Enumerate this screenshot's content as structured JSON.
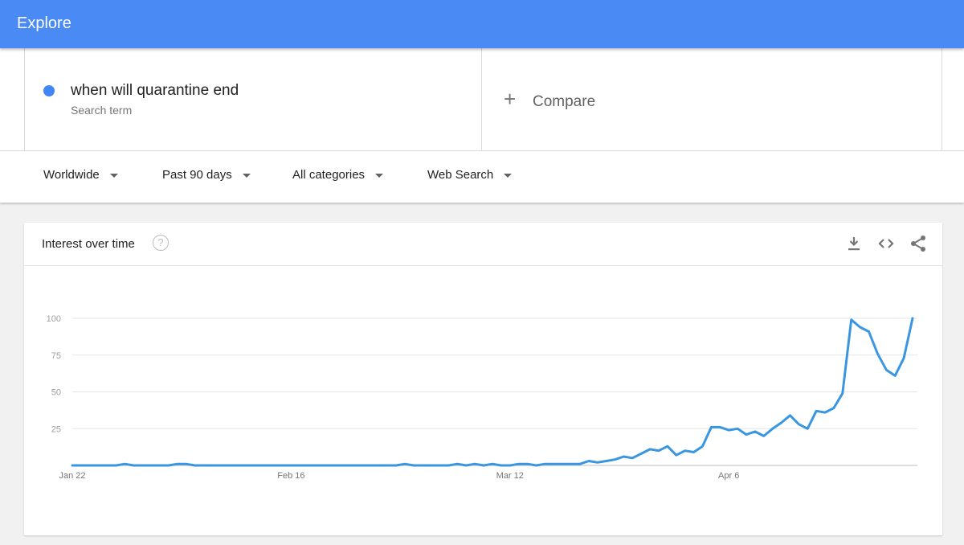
{
  "header": {
    "title": "Explore"
  },
  "search_term": {
    "text": "when will quarantine end",
    "subtitle": "Search term",
    "color": "#4285f4"
  },
  "compare": {
    "plus": "+",
    "label": "Compare"
  },
  "filters": [
    {
      "label": "Worldwide"
    },
    {
      "label": "Past 90 days"
    },
    {
      "label": "All categories"
    },
    {
      "label": "Web Search"
    }
  ],
  "card": {
    "title": "Interest over time",
    "help": "?",
    "icons": [
      "download-icon",
      "embed-code-icon",
      "share-icon"
    ]
  },
  "chart_data": {
    "type": "line",
    "title": "",
    "xlabel": "",
    "ylabel": "",
    "ylim": [
      0,
      100
    ],
    "yticks": [
      25,
      50,
      75,
      100
    ],
    "grid": true,
    "line_color": "#3a96e0",
    "x_ticks": [
      {
        "label": "Jan 22",
        "index": 0
      },
      {
        "label": "Feb 16",
        "index": 25
      },
      {
        "label": "Mar 12",
        "index": 50
      },
      {
        "label": "Apr 6",
        "index": 75
      }
    ],
    "values": [
      0,
      0,
      0,
      0,
      0,
      0,
      1,
      0,
      0,
      0,
      0,
      0,
      1,
      1,
      0,
      0,
      0,
      0,
      0,
      0,
      0,
      0,
      0,
      0,
      0,
      0,
      0,
      0,
      0,
      0,
      0,
      0,
      0,
      0,
      0,
      0,
      0,
      0,
      1,
      0,
      0,
      0,
      0,
      0,
      1,
      0,
      1,
      0,
      1,
      0,
      0,
      1,
      1,
      0,
      1,
      1,
      1,
      1,
      1,
      3,
      2,
      3,
      4,
      6,
      5,
      8,
      11,
      10,
      13,
      7,
      10,
      9,
      13,
      26,
      26,
      24,
      25,
      21,
      23,
      20,
      25,
      29,
      34,
      28,
      25,
      37,
      36,
      39,
      49,
      99,
      94,
      91,
      76,
      65,
      61,
      73,
      100
    ]
  }
}
